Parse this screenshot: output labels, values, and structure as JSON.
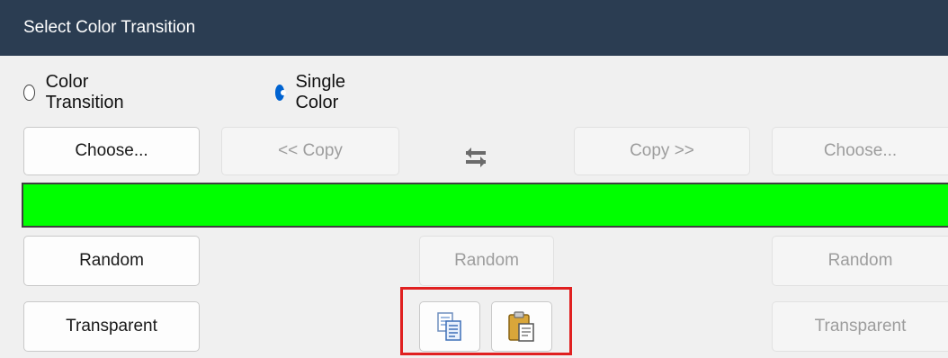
{
  "title": "Select Color Transition",
  "radios": {
    "color_transition": {
      "label": "Color Transition",
      "checked": false
    },
    "single_color": {
      "label": "Single Color",
      "checked": true
    }
  },
  "row1": {
    "left_choose": "Choose...",
    "copy_left": "<< Copy",
    "swap_icon": "swap-arrows-icon",
    "copy_right": "Copy >>",
    "right_choose": "Choose..."
  },
  "swatch_color": "#00ff00",
  "row2": {
    "left_random": "Random",
    "mid_random": "Random",
    "right_random": "Random"
  },
  "row3": {
    "left_transparent": "Transparent",
    "copy_icon": "copy-icon",
    "paste_icon": "paste-icon",
    "right_transparent": "Transparent"
  },
  "highlight_color": "#e02020"
}
